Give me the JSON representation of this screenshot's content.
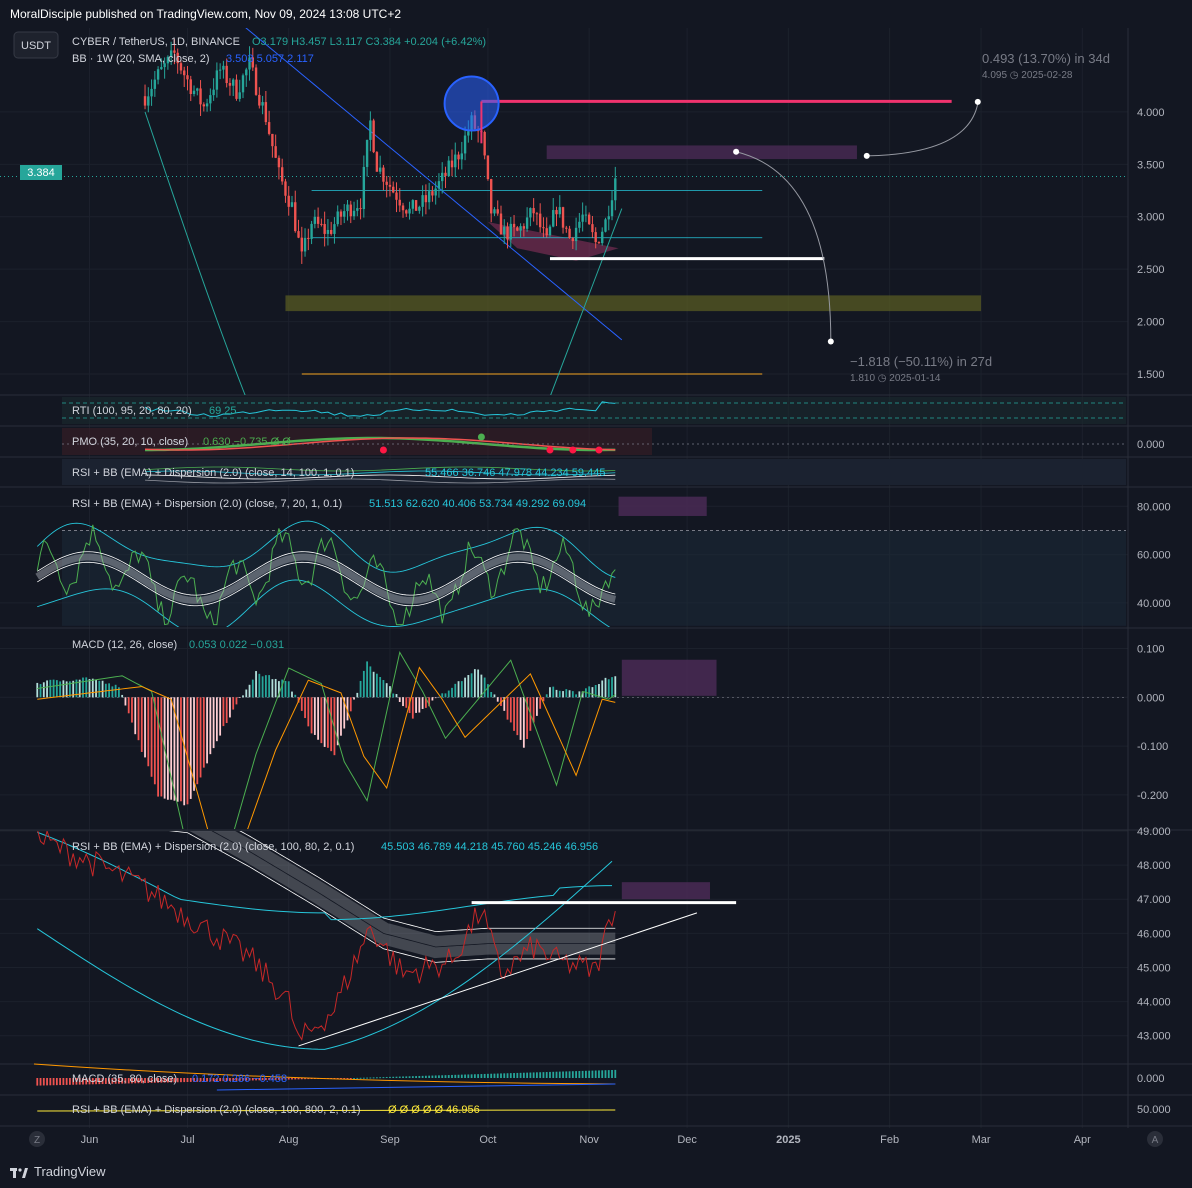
{
  "header": {
    "published": "MoralDisciple published on TradingView.com, Nov 09, 2024 13:08 UTC+2"
  },
  "footer": {
    "brand": "TradingView"
  },
  "colors": {
    "bg": "#131722",
    "up": "#26a69a",
    "down": "#ef5350",
    "grid": "#1f2430",
    "text": "#b2b5be",
    "bb": "#2962ff"
  },
  "main_pane": {
    "currency": "USDT",
    "symbol": "CYBER / TetherUS, 1D, BINANCE",
    "ohlc": "O3.179 H3.457 L3.117 C3.384 +0.204 (+6.42%)",
    "bb": "BB · 1W (20, SMA, close, 2)",
    "bb_values": "3.503 5.057 2.117",
    "price_tag": "3.384",
    "proj_up": "0.493 (13.70%) in 34d",
    "proj_up_sub": "4.095 ◷ 2025-02-28",
    "proj_down": "−1.818 (−50.11%) in 27d",
    "proj_down_sub": "1.810 ◷ 2025-01-14"
  },
  "indicators": {
    "rti": "RTI (100, 95, 20, 80, 20)",
    "rti_vals": "69 25",
    "pmo": "PMO (35, 20, 10, close)",
    "pmo_vals": "0.630 −0.735 Ø Ø",
    "pmo_axis": "0.000",
    "rsi1": "RSI + BB (EMA) + Dispersion (2.0) (close, 14, 100, 1, 0.1)",
    "rsi1_vals": "55.466 36.746 47.978 44.234 59.445",
    "rsi2": "RSI + BB (EMA) + Dispersion (2.0) (close, 7, 20, 1, 0.1)",
    "rsi2_vals": "51.513 62.620 40.406 53.734 49.292 69.094",
    "macd": "MACD (12, 26, close)",
    "macd_vals": "0.053 0.022 −0.031",
    "rsi3": "RSI + BB (EMA) + Dispersion (2.0) (close, 100, 80, 2, 0.1)",
    "rsi3_vals": "45.503 46.789 44.218 45.760 45.246 46.956",
    "macd2": "MACD (35, 80, close)",
    "macd2_vals": "0.172 0.286 −0.458",
    "macd2_axis": "0.000",
    "rsi4": "RSI + BB (EMA) + Dispersion (2.0) (close, 100, 800, 2, 0.1)",
    "rsi4_vals": "Ø Ø Ø Ø Ø 46.956",
    "rsi4_axis": "50.000"
  },
  "time_axis": [
    "Jun",
    "Jul",
    "Aug",
    "Sep",
    "Oct",
    "Nov",
    "Dec",
    "2025",
    "Feb",
    "Mar",
    "Apr"
  ],
  "chart_data": [
    {
      "type": "candlestick",
      "series": [
        {
          "name": "CYBER / TetherUS, 1D, BINANCE"
        }
      ],
      "x_range": [
        "2024-05-15",
        "2025-04-15"
      ],
      "ylim": [
        1.3,
        4.8
      ],
      "y_ticks": [
        "4.000",
        "3.500",
        "3.000",
        "2.500",
        "2.000",
        "1.500"
      ],
      "y_tick_values": [
        4.0,
        3.5,
        3.0,
        2.5,
        2.0,
        1.5
      ],
      "close_path": [
        [
          "2024-06-18",
          4.15
        ],
        [
          "2024-06-22",
          4.35
        ],
        [
          "2024-06-27",
          4.55
        ],
        [
          "2024-07-01",
          4.3
        ],
        [
          "2024-07-06",
          4.05
        ],
        [
          "2024-07-11",
          4.4
        ],
        [
          "2024-07-16",
          4.2
        ],
        [
          "2024-07-20",
          4.45
        ],
        [
          "2024-07-25",
          3.95
        ],
        [
          "2024-07-29",
          3.4
        ],
        [
          "2024-08-02",
          3.1
        ],
        [
          "2024-08-05",
          2.6
        ],
        [
          "2024-08-08",
          2.95
        ],
        [
          "2024-08-13",
          2.85
        ],
        [
          "2024-08-18",
          3.05
        ],
        [
          "2024-08-23",
          3.15
        ],
        [
          "2024-08-26",
          3.9
        ],
        [
          "2024-08-28",
          3.5
        ],
        [
          "2024-09-02",
          3.25
        ],
        [
          "2024-09-07",
          3.05
        ],
        [
          "2024-09-12",
          3.15
        ],
        [
          "2024-09-17",
          3.35
        ],
        [
          "2024-09-22",
          3.6
        ],
        [
          "2024-09-26",
          3.9
        ],
        [
          "2024-09-29",
          3.75
        ],
        [
          "2024-10-02",
          3.05
        ],
        [
          "2024-10-06",
          2.85
        ],
        [
          "2024-10-10",
          2.85
        ],
        [
          "2024-10-15",
          3.05
        ],
        [
          "2024-10-19",
          2.75
        ],
        [
          "2024-10-22",
          3.1
        ],
        [
          "2024-10-26",
          2.8
        ],
        [
          "2024-10-30",
          3.0
        ],
        [
          "2024-11-03",
          2.75
        ],
        [
          "2024-11-06",
          2.95
        ],
        [
          "2024-11-09",
          3.384
        ]
      ],
      "levels": [
        3.25,
        2.8,
        1.5
      ],
      "resistance_line": {
        "value": 4.1,
        "from": "2024-09-29",
        "to": "2025-02-20"
      },
      "support_line": {
        "value": 2.6,
        "from": "2024-10-20",
        "to": "2025-01-12"
      },
      "zone_low": {
        "from": 2.1,
        "to": 2.25,
        "start": "2024-07-31",
        "end": "2025-03-01"
      },
      "zone_high": {
        "from": 3.55,
        "to": 3.68,
        "start": "2024-10-19",
        "end": "2025-01-22"
      },
      "current_price": 3.384
    },
    {
      "type": "line",
      "series": [
        {
          "name": "RSI + BB (EMA) + Dispersion (2.0) (close, 7, 20, 1, 0.1)"
        }
      ],
      "ylim": [
        30,
        88
      ],
      "y_ticks": [
        "80.000",
        "60.000",
        "40.000"
      ],
      "y_tick_values": [
        80,
        60,
        40
      ],
      "overbought": 70,
      "oversold": 30
    },
    {
      "type": "bar",
      "series": [
        {
          "name": "MACD (12, 26, close)"
        }
      ],
      "ylim": [
        -0.27,
        0.14
      ],
      "y_ticks": [
        "0.100",
        "0.000",
        "-0.100",
        "-0.200"
      ],
      "y_tick_values": [
        0.1,
        0.0,
        -0.1,
        -0.2
      ]
    },
    {
      "type": "line",
      "series": [
        {
          "name": "RSI + BB (EMA) + Dispersion (2.0) (close, 100, 80, 2, 0.1)"
        }
      ],
      "ylim": [
        42.2,
        49.0
      ],
      "y_ticks": [
        "49.000",
        "48.000",
        "47.000",
        "46.000",
        "45.000",
        "44.000",
        "43.000"
      ],
      "y_tick_values": [
        49,
        48,
        47,
        46,
        45,
        44,
        43
      ],
      "resistance": 46.9,
      "trendline": [
        [
          "2024-08-04",
          42.7
        ],
        [
          "2024-12-04",
          46.6
        ]
      ]
    }
  ]
}
